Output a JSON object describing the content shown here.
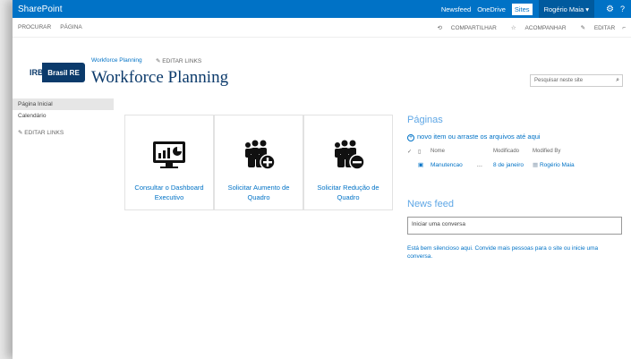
{
  "suitebar": {
    "brand": "SharePoint",
    "links": [
      "Newsfeed",
      "OneDrive",
      "Sites"
    ],
    "user": "Rogério Maia ▾"
  },
  "ribbon": {
    "tabs": [
      "PROCURAR",
      "PÁGINA"
    ],
    "share": "COMPARTILHAR",
    "follow": "ACOMPANHAR",
    "edit": "EDITAR"
  },
  "header": {
    "logo_left": "IRB",
    "logo_right": "Brasil RE",
    "breadcrumb": "Workforce Planning",
    "edit_links": "EDITAR LINKS",
    "title": "Workforce Planning",
    "search_placeholder": "Pesquisar neste site"
  },
  "leftnav": {
    "items": [
      "Página Inicial",
      "Calendário"
    ],
    "edit_links": "EDITAR LINKS"
  },
  "tiles": [
    {
      "label": "Consultar o Dashboard Executivo",
      "icon": "dashboard-icon"
    },
    {
      "label": "Solicitar Aumento de Quadro",
      "icon": "add-people-icon"
    },
    {
      "label": "Solicitar Redução de Quadro",
      "icon": "remove-people-icon"
    }
  ],
  "pages": {
    "heading": "Páginas",
    "new_item": "novo item ou arraste os arquivos até aqui",
    "columns": {
      "name": "Nome",
      "modified": "Modificado",
      "modified_by": "Modified By"
    },
    "rows": [
      {
        "name": "Manutencao",
        "modified": "8 de janeiro",
        "modified_by": "Rogério Maia"
      }
    ]
  },
  "newsfeed": {
    "heading": "News feed",
    "placeholder": "Iniciar uma conversa",
    "empty_text": "Está bem silencioso aqui. Convide mais pessoas para o site ou inicie uma conversa."
  },
  "colors": {
    "suitebar": "#0072c6",
    "title": "#0b3a6b",
    "accent": "#5fa7e6"
  }
}
